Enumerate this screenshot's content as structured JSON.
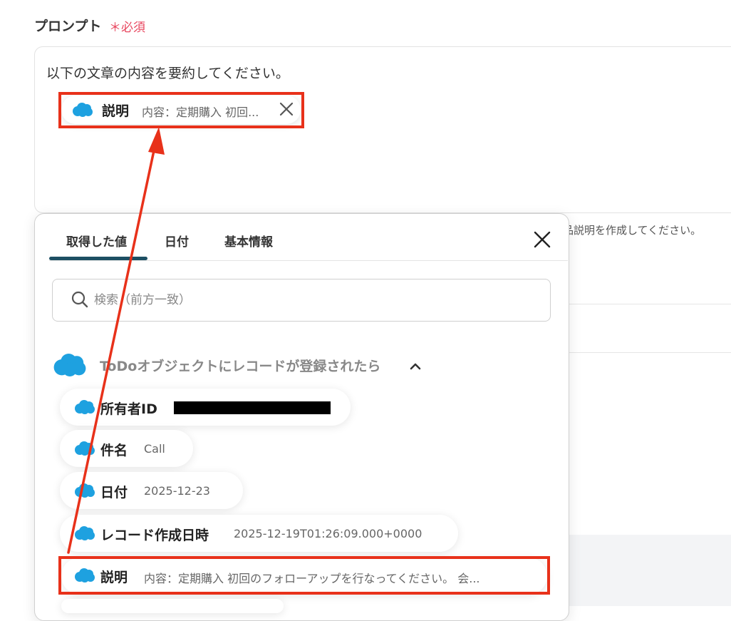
{
  "field": {
    "label": "プロンプト",
    "required": "＊必須",
    "prompt_text": "以下の文章の内容を要約してください。",
    "inserted_chip": {
      "label": "説明",
      "value": "内容：定期購入 初回..."
    }
  },
  "background": {
    "hint_text": "品説明を作成してください。"
  },
  "popup": {
    "tabs": [
      {
        "label": "取得した値"
      },
      {
        "label": "日付"
      },
      {
        "label": "基本情報"
      }
    ],
    "search": {
      "placeholder": "検索（前方一致）"
    },
    "group": {
      "title": "ToDoオブジェクトにレコードが登録されたら"
    },
    "items": [
      {
        "label": "所有者ID",
        "value": ""
      },
      {
        "label": "件名",
        "value": "Call"
      },
      {
        "label": "日付",
        "value": "2025-12-23"
      },
      {
        "label": "レコード作成日時",
        "value": "2025-12-19T01:26:09.000+0000"
      },
      {
        "label": "説明",
        "value": "内容：定期購入 初回のフォローアップを行なってください。 会..."
      }
    ]
  },
  "colors": {
    "accent": "#1d4f63",
    "highlight": "#e8311a",
    "required": "#e8475f",
    "salesforce": "#1ea1e0"
  },
  "icons": [
    "salesforce-cloud-icon",
    "close-icon",
    "search-icon",
    "chevron-up-icon",
    "remove-icon"
  ]
}
